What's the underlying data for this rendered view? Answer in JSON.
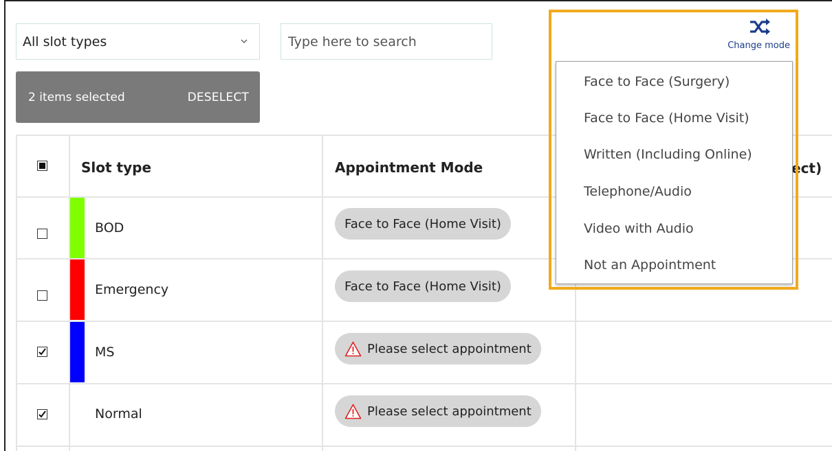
{
  "filters": {
    "slot_type_select": {
      "value": "All slot types"
    },
    "search": {
      "placeholder": "Type here to search"
    }
  },
  "selection": {
    "count_label": "2 items selected",
    "deselect_label": "DESELECT"
  },
  "table": {
    "headers": {
      "slot_type": "Slot type",
      "appointment_mode": "Appointment Mode",
      "third_column_visible": "ect)"
    },
    "header_checkbox": "partial",
    "rows": [
      {
        "name": "BOD",
        "color": "#7fff00",
        "checked": false,
        "mode": "Face to Face (Home Visit)",
        "warning": false
      },
      {
        "name": "Emergency",
        "color": "#ff0000",
        "checked": false,
        "mode": "Face to Face (Home Visit)",
        "warning": false
      },
      {
        "name": "MS",
        "color": "#0000ff",
        "checked": true,
        "mode": "Please select appointment",
        "warning": true
      },
      {
        "name": "Normal",
        "color": "",
        "checked": true,
        "mode": "Please select appointment",
        "warning": true
      }
    ]
  },
  "change_mode": {
    "icon": "shuffle-icon",
    "label": "Change mode",
    "options": [
      "Face to Face (Surgery)",
      "Face to Face (Home Visit)",
      "Written (Including Online)",
      "Telephone/Audio",
      "Video with Audio",
      "Not an Appointment"
    ]
  },
  "colors": {
    "selection_bar": "#7a7a7a",
    "highlight": "#f2a91b",
    "pill": "#d6d6d6",
    "link": "#1a3b8c",
    "warning": "#e02020"
  }
}
